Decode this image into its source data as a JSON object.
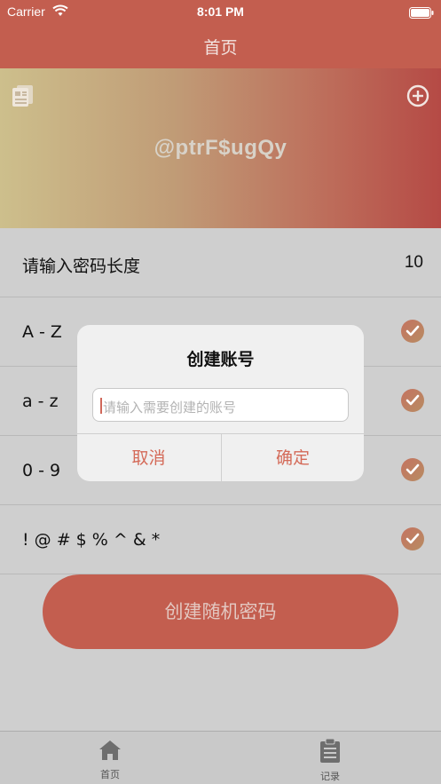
{
  "status_bar": {
    "carrier": "Carrier",
    "time": "8:01 PM"
  },
  "nav": {
    "title": "首页"
  },
  "hero": {
    "password": "@ptrF$ugQy",
    "left_icon": "list-document-icon",
    "right_icon": "plus-circle-icon"
  },
  "options": [
    {
      "label": "请输入密码长度",
      "value": "10",
      "type": "length"
    },
    {
      "label": "A - Z",
      "checked": true
    },
    {
      "label": "a - z",
      "checked": true
    },
    {
      "label": "0 - 9",
      "checked": true
    },
    {
      "label": "! @ # $ % ^ & *",
      "checked": true
    }
  ],
  "create_button": {
    "label": "创建随机密码"
  },
  "dialog": {
    "title": "创建账号",
    "input_placeholder": "请输入需要创建的账号",
    "input_value": "",
    "cancel_label": "取消",
    "confirm_label": "确定"
  },
  "tabs": [
    {
      "label": "首页",
      "icon": "home-icon"
    },
    {
      "label": "记录",
      "icon": "clipboard-icon"
    }
  ],
  "colors": {
    "brand": "#c35e4f",
    "accent_text": "#d46a58"
  }
}
